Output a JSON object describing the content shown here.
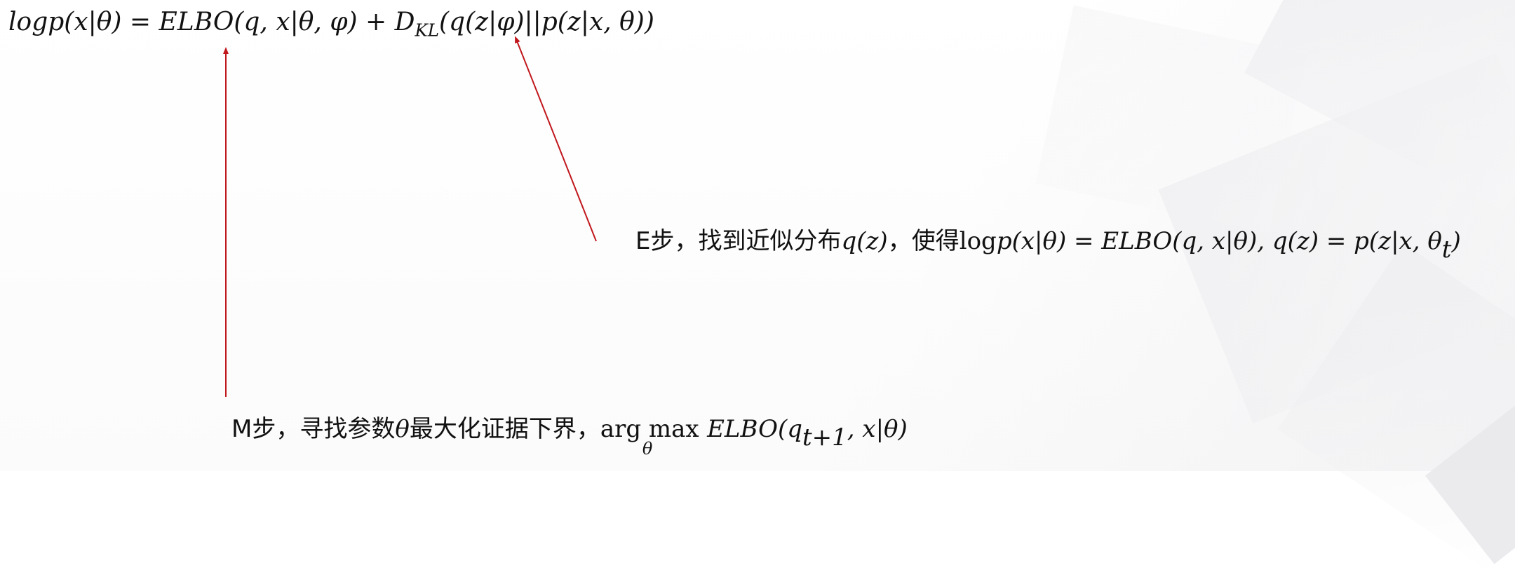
{
  "formula_main": {
    "lhs": "logp(x|θ) = ELBO(q, x|θ, φ) + D",
    "kl_sub": "KL",
    "rhs": "(q(z|φ)||p(z|x, θ))"
  },
  "e_step": {
    "label": "E步，找到近似分布",
    "qz": "q(z)",
    "mid": "，使得",
    "log_text": "log",
    "expr1": "p(x|θ) = ELBO(q, x|θ), q(z) = p(z|x, θ",
    "sub_t": "t",
    "close": ")"
  },
  "m_step": {
    "label": "M步，寻找参数",
    "theta": "θ",
    "label2": "最大化证据下界，",
    "argmax": "arg max",
    "under": "θ",
    "expr_a": "ELBO(q",
    "sub_t1": "t+1",
    "expr_b": ", x|θ)"
  },
  "colors": {
    "arrow": "#c0171c",
    "text": "#111111"
  }
}
